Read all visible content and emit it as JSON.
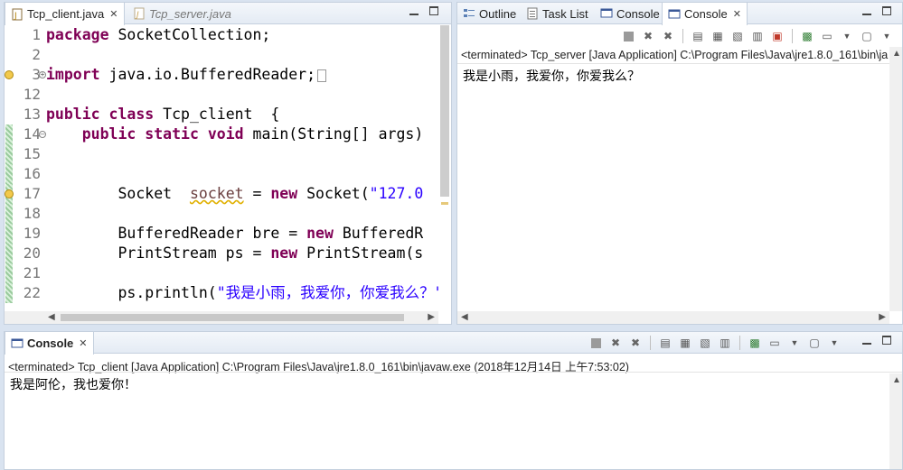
{
  "editor": {
    "tabs": [
      {
        "label": "Tcp_client.java",
        "active": true
      },
      {
        "label": "Tcp_server.java",
        "active": false
      }
    ],
    "lines": [
      {
        "num": "1",
        "html": "<span class='kw'>package</span> SocketCollection;"
      },
      {
        "num": "2",
        "html": ""
      },
      {
        "num": "3",
        "html": "<span class='kw'>import</span> java.io.BufferedReader;<span class='fold-box'></span>"
      },
      {
        "num": "12",
        "html": ""
      },
      {
        "num": "13",
        "html": "<span class='kw'>public</span> <span class='kw'>class</span> Tcp_client  {"
      },
      {
        "num": "14",
        "html": "    <span class='kw'>public</span> <span class='kw'>static</span> <span class='kw'>void</span> main(String[] args)"
      },
      {
        "num": "15",
        "html": ""
      },
      {
        "num": "16",
        "html": ""
      },
      {
        "num": "17",
        "html": "        Socket  <span class='var squiggle'>socket</span> = <span class='kw'>new</span> Socket(<span class='str'>\"127.0</span>"
      },
      {
        "num": "18",
        "html": ""
      },
      {
        "num": "19",
        "html": "        BufferedReader bre = <span class='kw'>new</span> BufferedR"
      },
      {
        "num": "20",
        "html": "        PrintStream ps = <span class='kw'>new</span> PrintStream(s"
      },
      {
        "num": "21",
        "html": ""
      },
      {
        "num": "22",
        "html": "        ps.println(<span class='str'>\"我是小雨，我爱你，你爱我么？\"</span>"
      }
    ]
  },
  "right_panel": {
    "tabs": [
      {
        "label": "Outline"
      },
      {
        "label": "Task List"
      },
      {
        "label": "Console"
      },
      {
        "label": "Console",
        "active": true
      }
    ],
    "status": "<terminated> Tcp_server [Java Application] C:\\Program Files\\Java\\jre1.8.0_161\\bin\\ja",
    "output": "我是小雨，我爱你，你爱我么？"
  },
  "bottom_panel": {
    "tab_label": "Console",
    "status": "<terminated> Tcp_client [Java Application] C:\\Program Files\\Java\\jre1.8.0_161\\bin\\javaw.exe (2018年12月14日 上午7:53:02)",
    "output": "我是阿伦，我也爱你！"
  },
  "colors": {
    "keyword": "#7f0055",
    "string": "#2a00ff",
    "tab_border": "#c5d0de",
    "background": "#d9e3f0"
  }
}
